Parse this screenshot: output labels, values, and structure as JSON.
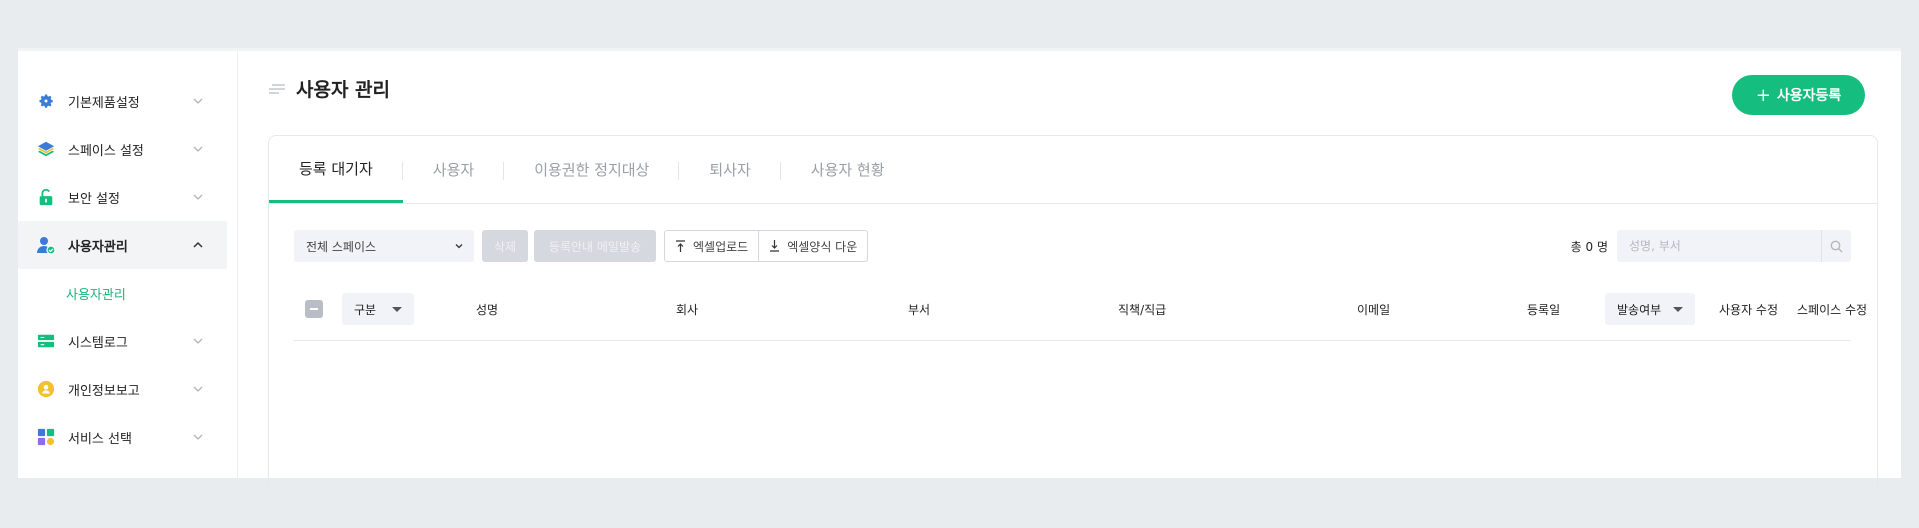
{
  "sidebar": {
    "items": [
      {
        "label": "기본제품설정",
        "icon": "gear-icon"
      },
      {
        "label": "스페이스 설정",
        "icon": "layers-icon"
      },
      {
        "label": "보안 설정",
        "icon": "lock-icon"
      },
      {
        "label": "사용자관리",
        "icon": "user-check-icon",
        "expanded": true
      },
      {
        "label": "시스템로그",
        "icon": "server-icon"
      },
      {
        "label": "개인정보보고",
        "icon": "person-circle-icon"
      },
      {
        "label": "서비스 선택",
        "icon": "grid-apps-icon"
      }
    ],
    "sub_item": "사용자관리"
  },
  "page": {
    "title": "사용자 관리",
    "add_button": "사용자등록"
  },
  "tabs": [
    {
      "label": "등록 대기자",
      "active": true
    },
    {
      "label": "사용자"
    },
    {
      "label": "이용권한 정지대상"
    },
    {
      "label": "퇴사자"
    },
    {
      "label": "사용자 현황"
    }
  ],
  "toolbar": {
    "space_select": "전체 스페이스",
    "delete_button": "삭제",
    "mail_button": "등록안내 메일발송",
    "excel_upload": "엑셀업로드",
    "excel_download": "엑셀양식 다운",
    "total": "총 0 명",
    "search_placeholder": "성명, 부서"
  },
  "table": {
    "headers": {
      "type": "구분",
      "name": "성명",
      "company": "회사",
      "department": "부서",
      "position": "직책/직급",
      "email": "이메일",
      "registered": "등록일",
      "sent": "발송여부",
      "edit_user": "사용자 수정",
      "edit_space": "스페이스 수정"
    }
  },
  "colors": {
    "accent": "#15bd7f",
    "disabled": "#d5d8de"
  }
}
